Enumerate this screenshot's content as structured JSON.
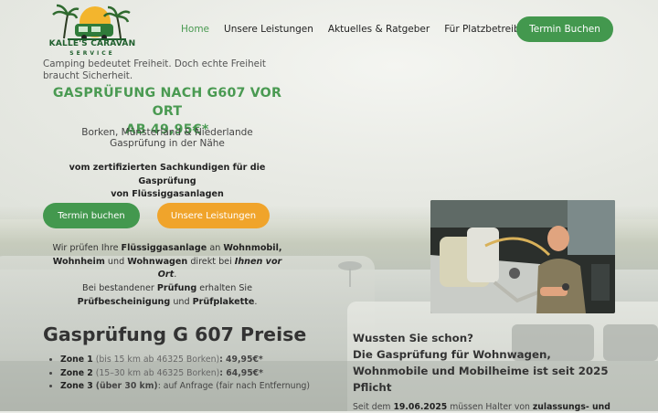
{
  "logo": {
    "title": "KALLE'S CARAVAN",
    "subtitle": "SERVICE"
  },
  "nav": [
    {
      "label": "Home",
      "active": true
    },
    {
      "label": "Unsere Leistungen"
    },
    {
      "label": "Aktuelles & Ratgeber"
    },
    {
      "label": "Für Platzbetreiber"
    }
  ],
  "header_cta": "Termin Buchen",
  "hero": {
    "tagline": "Camping bedeutet Freiheit. Doch echte Freiheit braucht Sicherheit.",
    "headline_1": "GASPRÜFUNG NACH G607 VOR ORT",
    "headline_2": "AB 49,95€*",
    "region_1": "Borken, Münsterland & Niederlande",
    "region_2": "Gasprüfung in der Nähe",
    "certified_1": "vom zertifizierten Sachkundigen für die Gasprüfung",
    "certified_2": "von Flüssiggasanlagen",
    "btn_primary": "Termin buchen",
    "btn_secondary": "Unsere Leistungen",
    "desc": {
      "p1": "Wir prüfen Ihre ",
      "b1": "Flüssiggasanlage",
      "p2": " an ",
      "b2": "Wohnmobil,",
      "b3": "Wohnheim",
      "p3": " und ",
      "b4": "Wohnwagen",
      "p4": " direkt bei ",
      "b5": "Ihnen vor Ort",
      "p5": ".",
      "p6": "Bei bestandener ",
      "b6": "Prüfung",
      "p7": " erhalten Sie",
      "b7": "Prüfbescheinigung",
      "p8": " und ",
      "b8": "Prüfplakette",
      "p9": "."
    }
  },
  "prices": {
    "title": "Gasprüfung G 607 Preise",
    "items": [
      {
        "zone": "Zone 1",
        "range": "(bis 15 km ab 46325 Borken)",
        "price": ": 49,95€*"
      },
      {
        "zone": "Zone 2",
        "range": "(15–30 km ab 46325 Borken)",
        "price": ": 64,95€*"
      },
      {
        "zone": "Zone 3",
        "range": "(über 30 km)",
        "price": ": auf Anfrage (fair nach Entfernung)"
      }
    ]
  },
  "info": {
    "line1": "Wussten Sie schon?",
    "line2": "Die Gasprüfung für Wohnwagen,",
    "line3": "Wohnmobile und Mobilheime ist seit 2025",
    "line4": "Pflicht",
    "since_1": "Seit dem ",
    "since_date": "19.06.2025",
    "since_2": " müssen Halter von ",
    "since_bold": "zulassungs- und"
  }
}
